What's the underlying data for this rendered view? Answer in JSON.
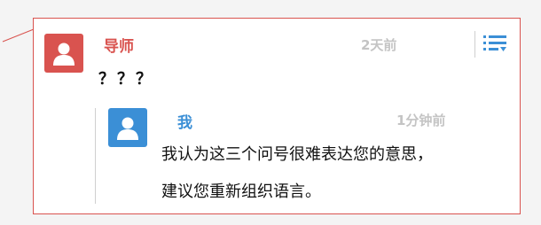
{
  "comment": {
    "author": "导师",
    "time": "2天前",
    "body": "？？？",
    "menu_icon": "list-menu-icon",
    "avatar_icon": "user-avatar-icon",
    "accent_color": "#d9534f"
  },
  "reply": {
    "author": "我",
    "time": "1分钟前",
    "body_line1": "我认为这三个问号很难表达您的意思，",
    "body_line2": "建议您重新组织语言。",
    "avatar_icon": "user-avatar-icon",
    "accent_color": "#3b8fd6"
  }
}
